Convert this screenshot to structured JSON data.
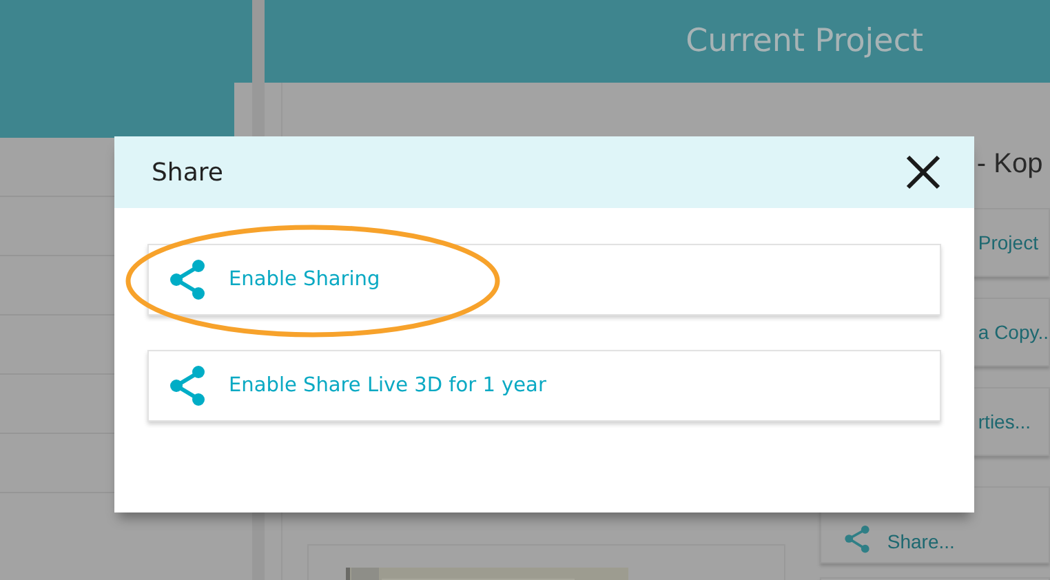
{
  "header": {
    "title": "Current Project"
  },
  "project": {
    "title": "- Kop"
  },
  "actions": [
    {
      "label": "Project",
      "kind": "text"
    },
    {
      "label": "a Copy..",
      "kind": "text"
    },
    {
      "label": "rties...",
      "kind": "text"
    },
    {
      "label": "Share...",
      "kind": "share"
    }
  ],
  "dialog": {
    "title": "Share",
    "options": [
      {
        "label": "Enable Sharing",
        "highlighted": true
      },
      {
        "label": "Enable Share Live 3D for 1 year",
        "highlighted": false
      }
    ]
  }
}
